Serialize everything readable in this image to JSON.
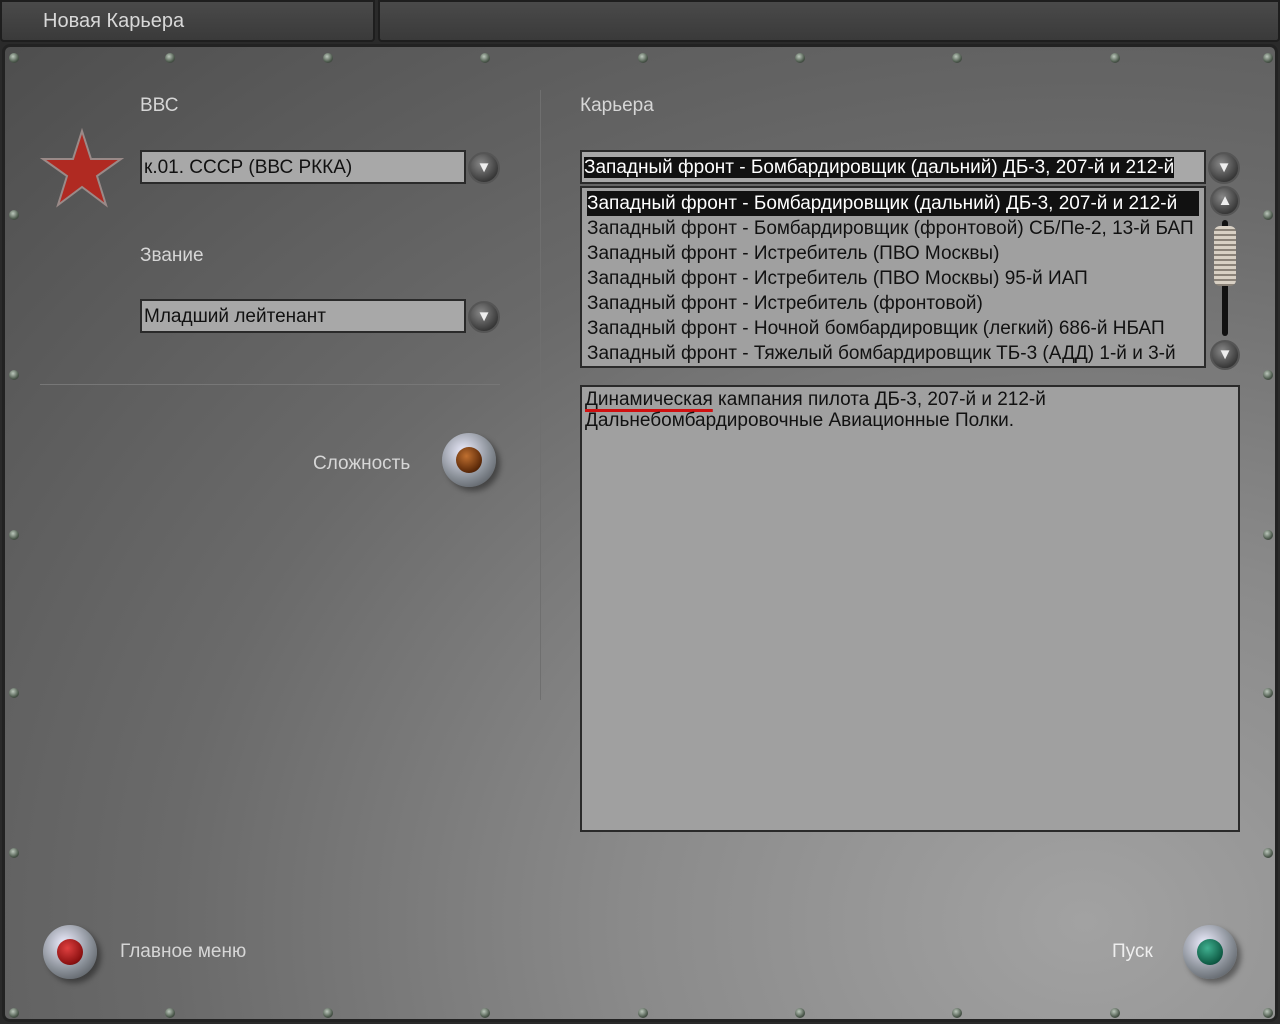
{
  "title": "Новая Карьера",
  "left": {
    "air_force_label": "ВВС",
    "air_force_value": "к.01. СССР (ВВС РККА)",
    "rank_label": "Звание",
    "rank_value": "Младший лейтенант",
    "difficulty_label": "Сложность"
  },
  "career": {
    "label": "Карьера",
    "selected": "Западный фронт - Бомбардировщик (дальний) ДБ-3, 207-й и 212-й",
    "items": [
      "Западный фронт - Бомбардировщик (дальний) ДБ-3, 207-й и 212-й",
      "Западный фронт - Бомбардировщик (фронтовой) СБ/Пе-2, 13-й БАП",
      "Западный фронт - Истребитель (ПВО Москвы)",
      "Западный фронт - Истребитель (ПВО Москвы) 95-й ИАП",
      "Западный фронт - Истребитель (фронтовой)",
      "Западный фронт - Ночной бомбардировщик (легкий) 686-й НБАП",
      "Западный фронт - Тяжелый бомбардировщик ТБ-3 (АДД) 1-й и 3-й"
    ],
    "description_underlined": "Динамическая",
    "description_rest": " кампания пилота ДБ-3, 207-й и 212-й Дальнебомбардировочные Авиационные Полки."
  },
  "bottom": {
    "main_menu": "Главное меню",
    "start": "Пуск"
  },
  "colors": {
    "star": "#b02a22",
    "red_lamp": "#b01820",
    "green_lamp": "#1a7a60",
    "amber_lamp": "#7a3a10"
  }
}
